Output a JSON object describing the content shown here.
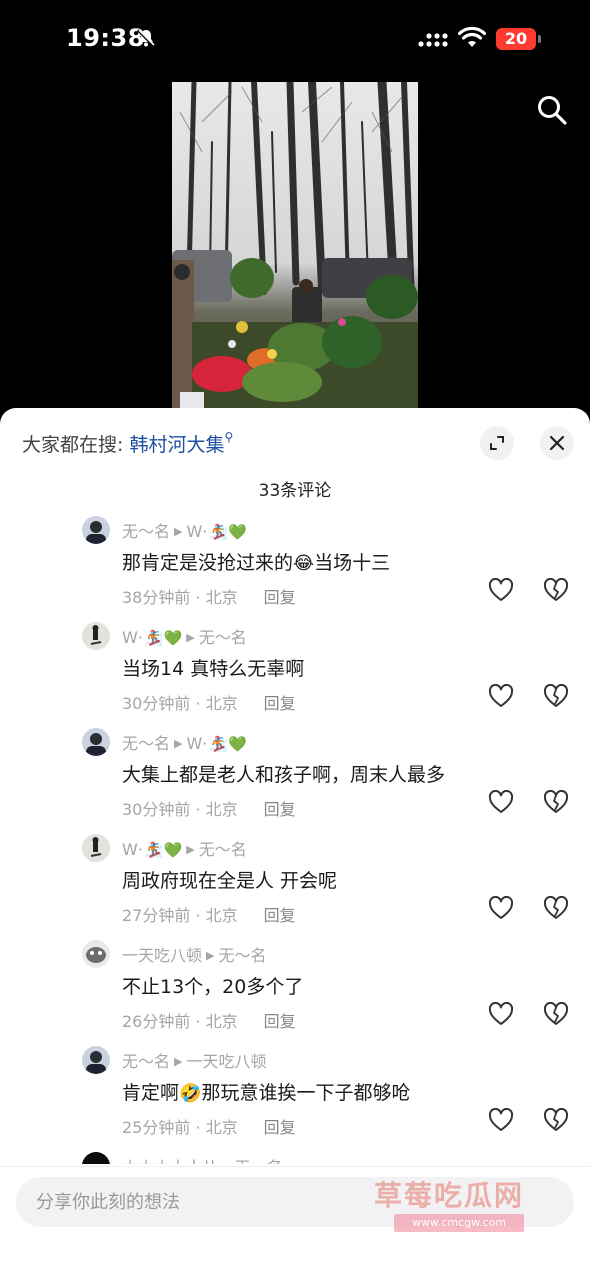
{
  "status_bar": {
    "time": "19:38",
    "battery": "20"
  },
  "sheet": {
    "search_prefix": "大家都在搜:",
    "search_keyword": "韩村河大集",
    "comment_count": "33条评论"
  },
  "comments": [
    {
      "names": [
        "无～名",
        "W·"
      ],
      "emojis": "🏂💚",
      "emojis_pos": 1,
      "text": "那肯定是没抢过来的",
      "text_emoji": "😂",
      "text_after": "当场十三",
      "time": "38分钟前 · 北京",
      "reply": "回复"
    },
    {
      "names": [
        "W·",
        "无～名"
      ],
      "emojis": "🏂💚",
      "emojis_pos": 0,
      "text": "当场14 真特么无辜啊",
      "text_emoji": "",
      "text_after": "",
      "time": "30分钟前 · 北京",
      "reply": "回复"
    },
    {
      "names": [
        "无～名",
        "W·"
      ],
      "emojis": "🏂💚",
      "emojis_pos": 1,
      "text": "大集上都是老人和孩子啊，周末人最多",
      "text_emoji": "",
      "text_after": "",
      "time": "30分钟前 · 北京",
      "reply": "回复"
    },
    {
      "names": [
        "W·",
        "无～名"
      ],
      "emojis": "🏂💚",
      "emojis_pos": 0,
      "text": "周政府现在全是人 开会呢",
      "text_emoji": "",
      "text_after": "",
      "time": "27分钟前 · 北京",
      "reply": "回复"
    },
    {
      "names": [
        "一天吃八顿",
        "无～名"
      ],
      "emojis": "",
      "emojis_pos": -1,
      "text": "不止13个，20多个了",
      "text_emoji": "",
      "text_after": "",
      "time": "26分钟前 · 北京",
      "reply": "回复"
    },
    {
      "names": [
        "无～名",
        "一天吃八顿"
      ],
      "emojis": "",
      "emojis_pos": -1,
      "text": "肯定啊",
      "text_emoji": "🤣",
      "text_after": "那玩意谁挨一下子都够呛",
      "time": "25分钟前 · 北京",
      "reply": "回复"
    },
    {
      "names": [
        "小小小大人儿",
        "无～名"
      ],
      "emojis": "",
      "emojis_pos": -1,
      "text": "",
      "text_emoji": "",
      "text_after": "",
      "time": "",
      "reply": ""
    }
  ],
  "input": {
    "placeholder": "分享你此刻的想法"
  },
  "watermark": {
    "title": "草莓吃瓜网",
    "url": "www.cmcgw.com"
  },
  "icons": {
    "top_right": "search-icon",
    "sheet_buttons": [
      "expand-icon",
      "close-icon"
    ],
    "comment_actions": [
      "heart-icon",
      "broken-heart-icon"
    ]
  }
}
